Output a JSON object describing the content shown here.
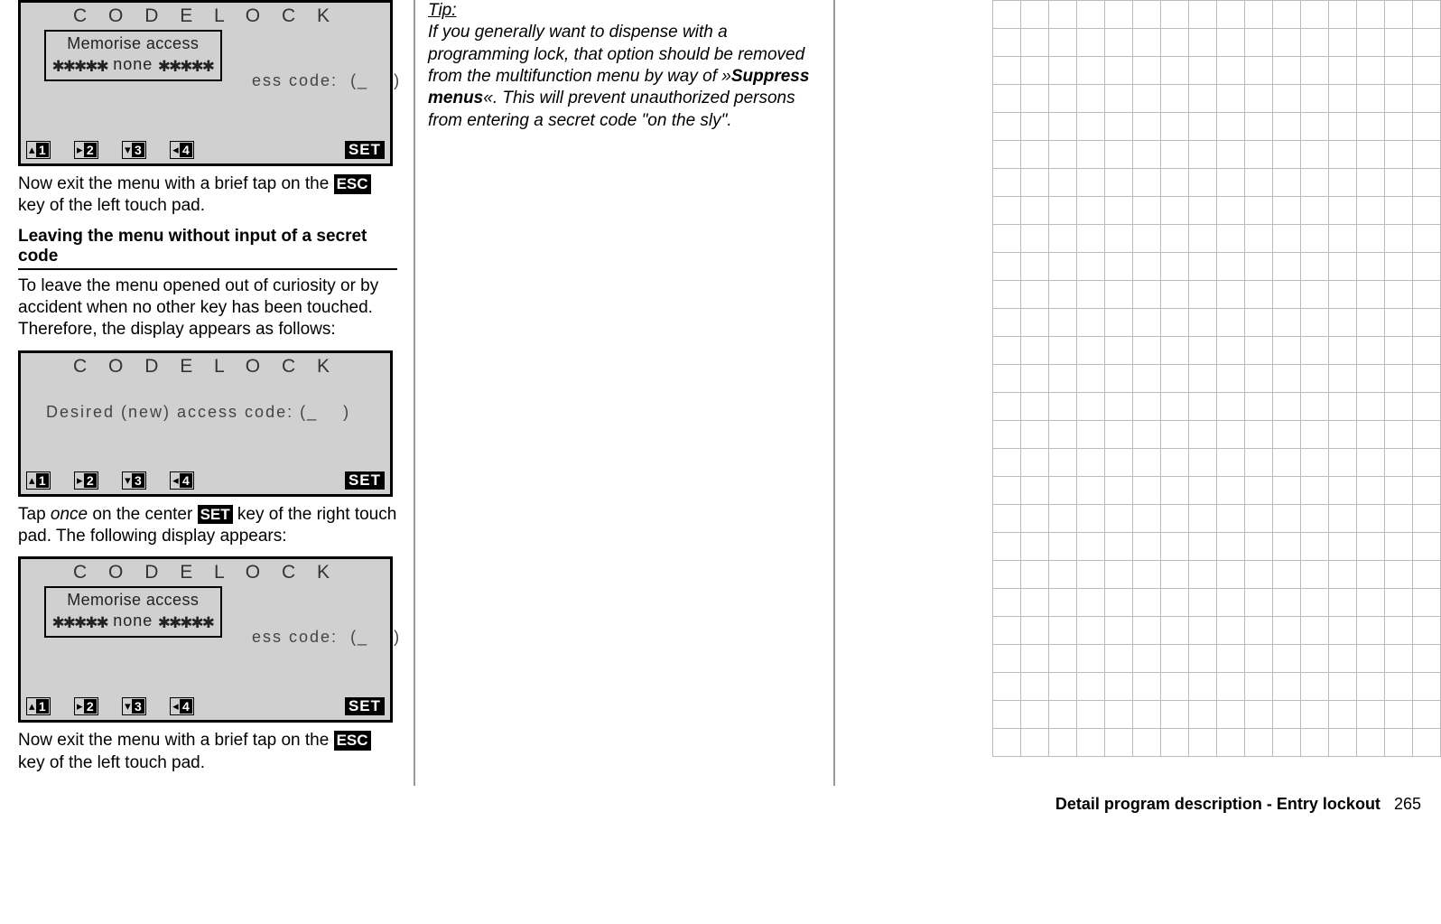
{
  "lcd": {
    "title": "C O D E    L O C K",
    "access_line_obscured": "ess code:  (_    )",
    "access_line_full": "Desired (new) access code: (_    )",
    "overlay_l1": "Memorise access",
    "overlay_l2_pre": "✱✱✱✱✱",
    "overlay_l2_mid": " none ",
    "overlay_l2_post": "✱✱✱✱✱",
    "nav": [
      "1",
      "2",
      "3",
      "4"
    ],
    "nav_arrows": [
      "▴",
      "▸",
      "▾",
      "◂"
    ],
    "set": "SET"
  },
  "text": {
    "p1a": "Now exit the menu with a brief tap on the ",
    "esc": "ESC",
    "p1b": " key of the left touch pad.",
    "hdr1": "Leaving the menu without input of a secret code",
    "p2": "To leave the menu opened out of curiosity or by accident when no other key has been touched. Therefore, the display appears as follows:",
    "p3a": "Tap ",
    "p3_i": "once",
    "p3b": " on the center ",
    "set_inline": "SET",
    "p3c": " key of the right touch pad. The following display appears:",
    "p4a": "Now exit the menu with a brief tap on the ",
    "p4b": " key of the left touch pad."
  },
  "tip": {
    "label": "Tip:",
    "body_a": "If you generally want to dispense with a programming lock, that option should be removed from the multifunction menu by way of »",
    "body_bold": "Suppress menus",
    "body_b": "«. This will prevent unauthorized persons from entering a secret code \"on the sly\"."
  },
  "footer": {
    "title": "Detail program description - Entry lockout",
    "page": "265"
  },
  "grid": {
    "rows": 27,
    "cols": 16
  }
}
